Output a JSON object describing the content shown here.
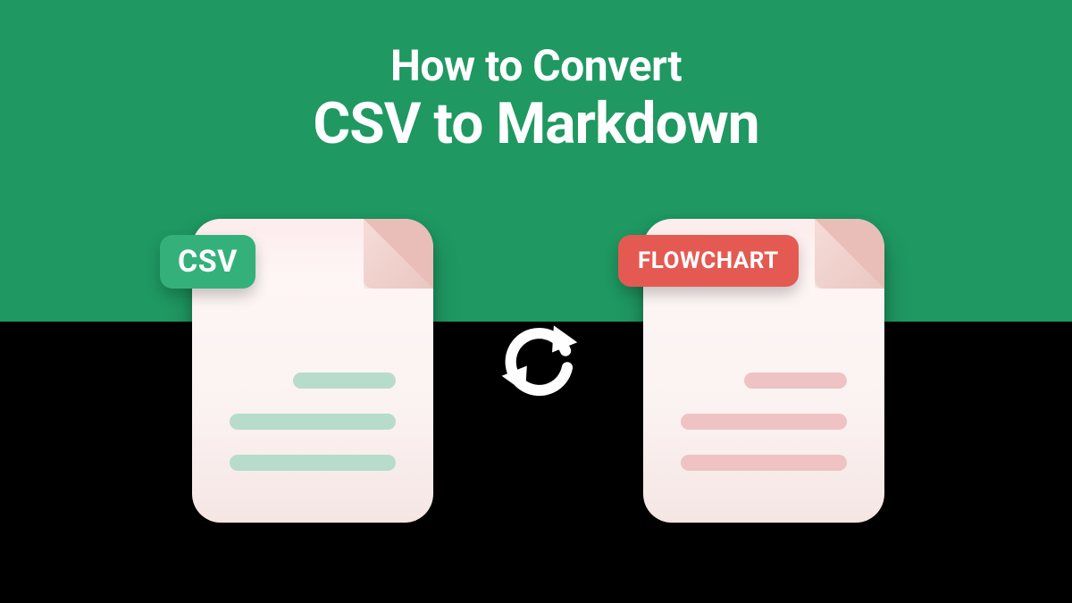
{
  "colors": {
    "bg_top": "#1f9862",
    "bg_bottom": "#000000",
    "badge_csv": "#34b17a",
    "badge_flow": "#e45a52",
    "line_green": "#b7dccb",
    "line_red": "#efc3c3",
    "title": "#ffffff"
  },
  "title": {
    "line1": "How to Convert",
    "line2": "CSV to Markdown"
  },
  "docs": {
    "left": {
      "badge": "CSV"
    },
    "right": {
      "badge": "FLOWCHART"
    }
  }
}
